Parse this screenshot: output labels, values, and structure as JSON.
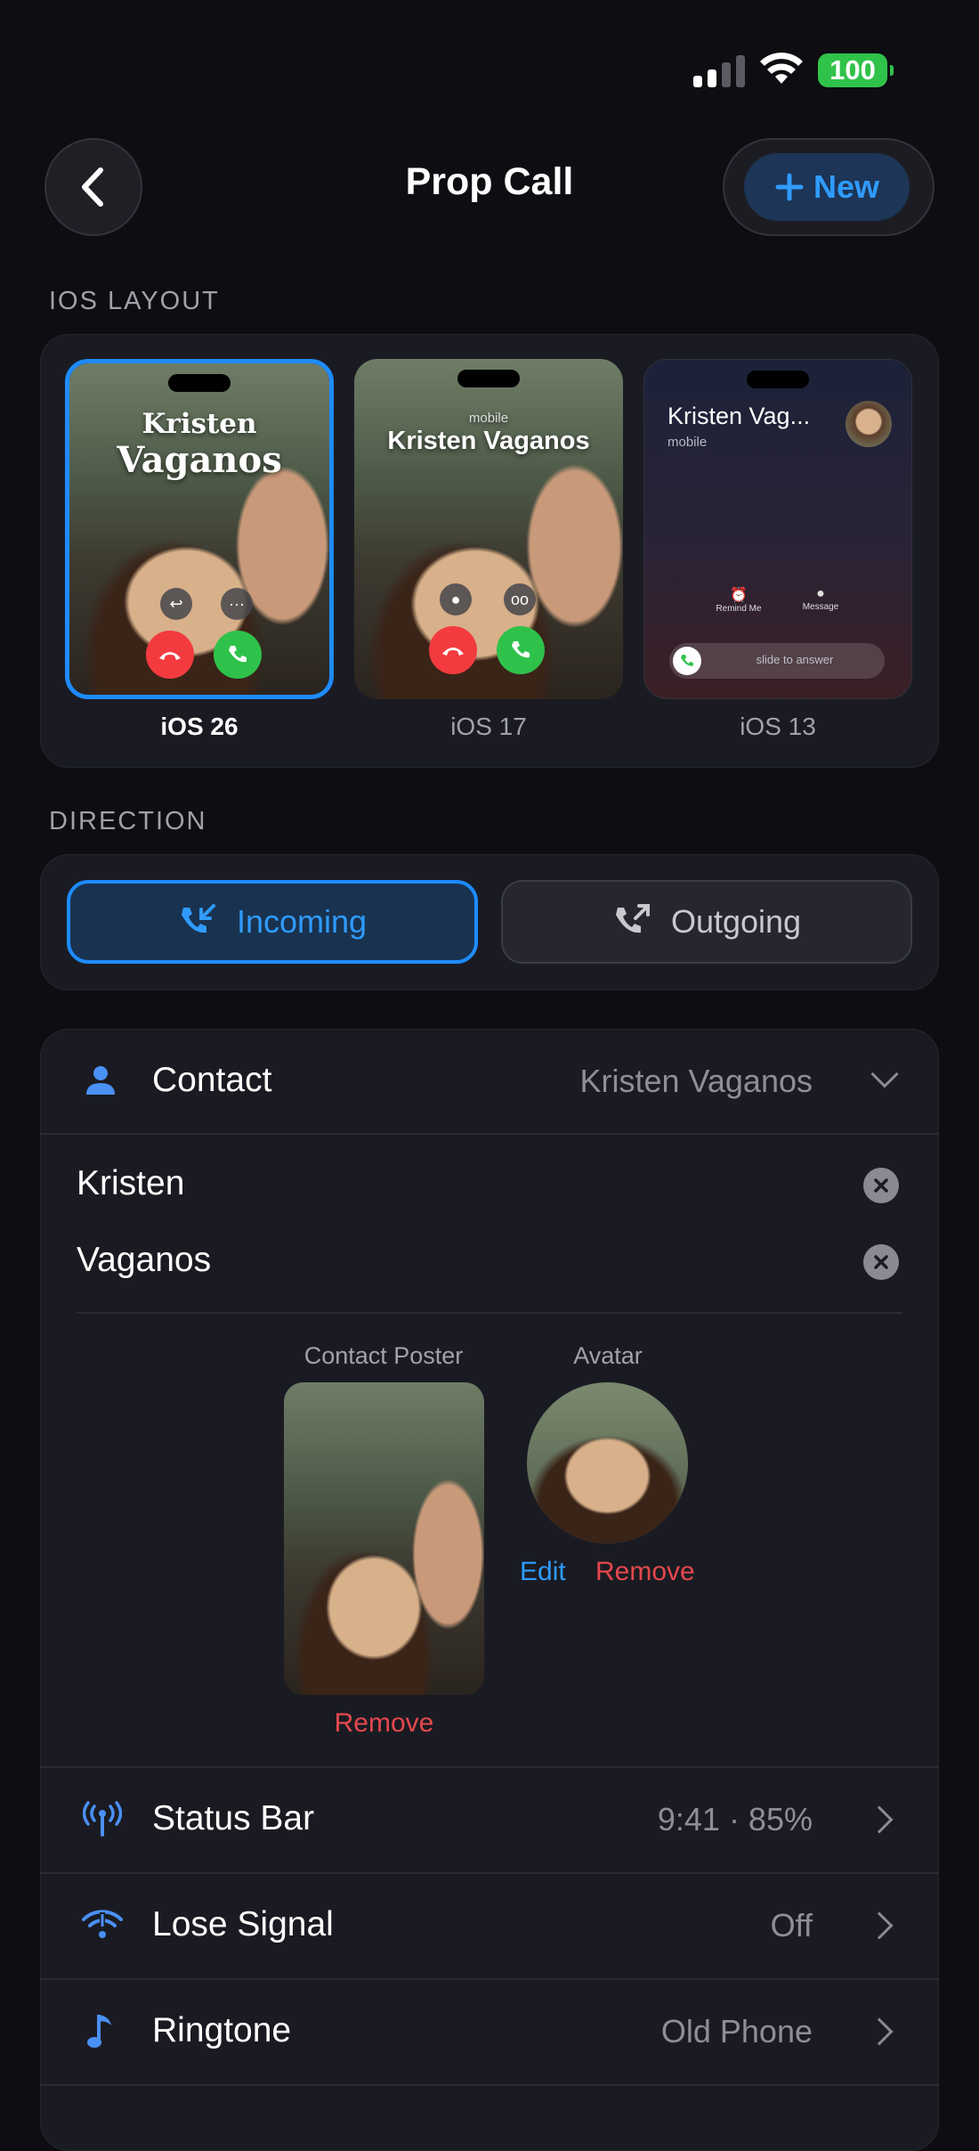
{
  "status_bar": {
    "battery": "100"
  },
  "header": {
    "title": "Prop Call",
    "new_label": "New"
  },
  "layout_section": {
    "label": "IOS LAYOUT",
    "options": [
      {
        "label": "iOS 26",
        "selected": true,
        "first": "Kristen",
        "last": "Vaganos"
      },
      {
        "label": "iOS 17",
        "selected": false,
        "sub": "mobile",
        "name": "Kristen Vaganos"
      },
      {
        "label": "iOS 13",
        "selected": false,
        "name": "Kristen Vag...",
        "sub": "mobile",
        "remind": "Remind Me",
        "message": "Message",
        "slide": "slide to answer"
      }
    ]
  },
  "direction": {
    "label": "DIRECTION",
    "incoming": "Incoming",
    "outgoing": "Outgoing",
    "selected": "Incoming"
  },
  "contact": {
    "label": "Contact",
    "value": "Kristen Vaganos",
    "first_name": "Kristen",
    "last_name": "Vaganos",
    "poster_label": "Contact Poster",
    "avatar_label": "Avatar",
    "edit": "Edit",
    "remove_avatar": "Remove",
    "remove_poster": "Remove"
  },
  "settings": [
    {
      "label": "Status Bar",
      "value": "9:41 · 85%",
      "icon": "antenna-icon"
    },
    {
      "label": "Lose Signal",
      "value": "Off",
      "icon": "no-signal-icon"
    },
    {
      "label": "Ringtone",
      "value": "Old Phone",
      "icon": "music-note-icon"
    }
  ],
  "colors": {
    "accent": "#1e8bff",
    "danger": "#e5484d",
    "green": "#2fc24b"
  }
}
